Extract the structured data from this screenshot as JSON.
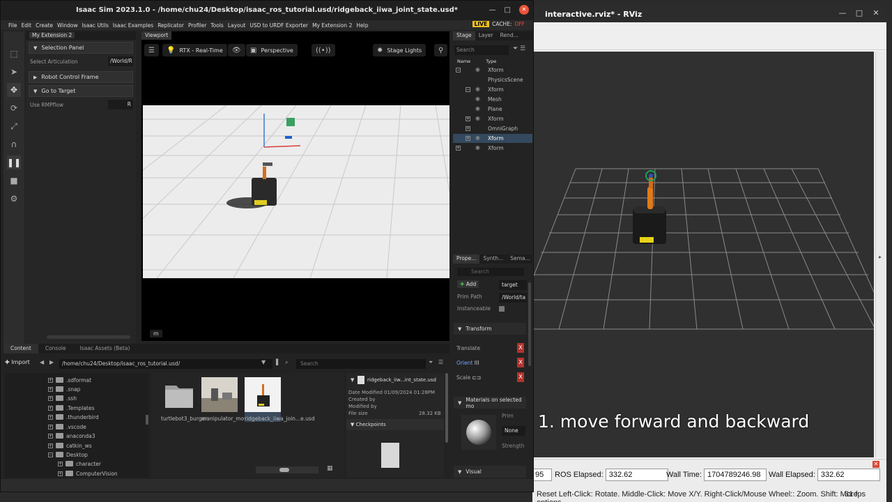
{
  "isaac": {
    "title": "Isaac Sim 2023.1.0 - /home/chu24/Desktop/isaac_ros_tutorial.usd/ridgeback_iiwa_joint_state.usd*",
    "menu": [
      "File",
      "Edit",
      "Create",
      "Window",
      "Isaac Utils",
      "Isaac Examples",
      "Replicator",
      "Profiler",
      "Tools",
      "Layout",
      "USD to URDF Exporter",
      "My Extension 2",
      "Help"
    ],
    "live": "LIVE",
    "cache_label": "CACHE:",
    "cache_state": "OFF",
    "extension": {
      "tab": "My Extension 2",
      "selection_panel": "Selection Panel",
      "select_articulation_label": "Select Articulation",
      "select_articulation_value": "/World/R",
      "robot_control_frame": "Robot Control Frame",
      "go_to_target": "Go to Target",
      "use_rmpflow_label": "Use RMPflow",
      "use_rmpflow_value": "R"
    },
    "viewport": {
      "tab": "Viewport",
      "render_mode": "RTX - Real-Time",
      "camera": "Perspective",
      "lights": "Stage Lights",
      "badge": "m"
    },
    "stage": {
      "tabs": [
        "Stage",
        "Layer",
        "Rend..."
      ],
      "search_placeholder": "Search",
      "col_name": "Name",
      "col_type": "Type",
      "rows": [
        "Xform",
        "PhysicsScene",
        "Xform",
        "Mesh",
        "Plane",
        "Xform",
        "OmniGraph",
        "Xform",
        "Xform"
      ]
    },
    "properties": {
      "tabs": [
        "Prope...",
        "Synth...",
        "Sema..."
      ],
      "search_placeholder": "Search",
      "add_label": "Add",
      "name_value": "target",
      "prim_path_label": "Prim Path",
      "prim_path_value": "/World/ta",
      "instanceable_label": "Instanceable",
      "transform_section": "Transform",
      "translate_label": "Translate",
      "orient_label": "Orient",
      "scale_label": "Scale",
      "x_label": "X",
      "materials_section": "Materials on selected mo",
      "prim_label": "Prim",
      "prim_value": "None",
      "strength_label": "Strength",
      "visual_section": "Visual"
    },
    "content": {
      "tabs": [
        "Content",
        "Console",
        "Isaac Assets (Beta)"
      ],
      "import_label": "Import",
      "path": "/home/chu24/Desktop/isaac_ros_tutorial.usd/",
      "search_placeholder": "Search",
      "tree": [
        ".sdformat",
        ".snap",
        ".ssh",
        ".Templates",
        ".thunderbird",
        ".vscode",
        "anaconda3",
        "catkin_ws",
        "Desktop",
        "character",
        "ComputerVision"
      ],
      "files": [
        "turtlebot3_burger",
        "manipulator_moveit.usd",
        "ridgeback_iiwa_join...e.usd"
      ],
      "detail_title": "ridgeback_iiw...int_state.usd",
      "date_modified": "Date Modified 01/09/2024 01:28PM",
      "created_by": "Created by",
      "modified_by": "Modified by",
      "file_size_label": "File size",
      "file_size_value": "28.32 KB",
      "checkpoints": "Checkpoints"
    }
  },
  "rviz": {
    "title": "interactive.rviz* - RViz",
    "ros_elapsed_label": "ROS Elapsed:",
    "ros_elapsed_value": "332.62",
    "wall_time_label": "Wall Time:",
    "wall_time_value": "1704789246.98",
    "wall_elapsed_label": "Wall Elapsed:",
    "wall_elapsed_value": "332.62",
    "partial_value": "95",
    "help_text": "Reset   Left-Click: Rotate. Middle-Click: Move X/Y. Right-Click/Mouse Wheel:: Zoom. Shift: More options.",
    "fps": "31 fps"
  },
  "subtitle": "1. move forward and backward",
  "colors": {
    "live_badge": "#f0c020",
    "close_button": "#e9543b",
    "x_axis_button": "#b0342d",
    "selection": "#34495e"
  }
}
